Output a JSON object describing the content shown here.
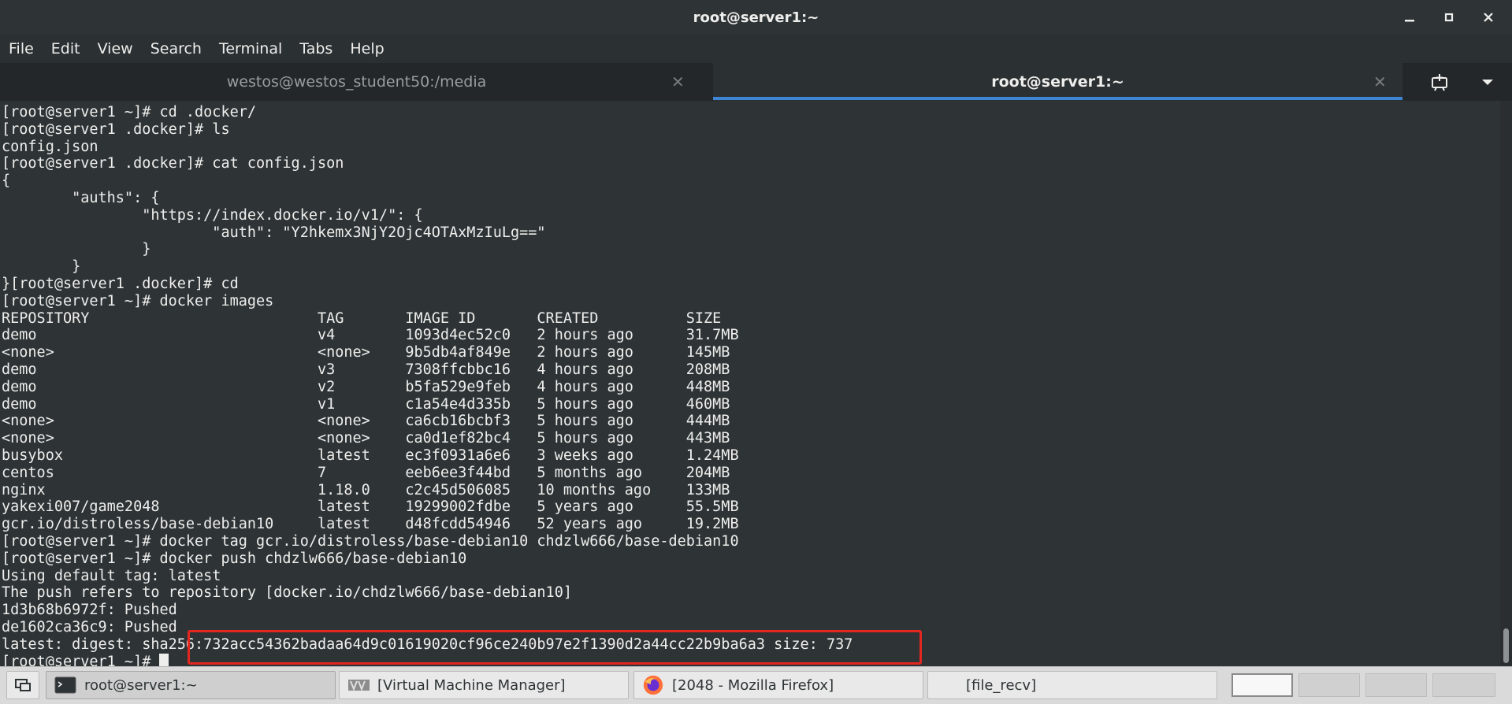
{
  "window": {
    "title": "root@server1:~",
    "icons": {
      "minimize": "minimize-icon",
      "maximize": "maximize-icon",
      "close": "close-icon"
    }
  },
  "menu": [
    "File",
    "Edit",
    "View",
    "Search",
    "Terminal",
    "Tabs",
    "Help"
  ],
  "tabs": [
    {
      "label": "westos@westos_student50:/media",
      "active": false
    },
    {
      "label": "root@server1:~",
      "active": true
    }
  ],
  "terminal": {
    "lines": [
      "[root@server1 ~]# cd .docker/",
      "[root@server1 .docker]# ls",
      "config.json",
      "[root@server1 .docker]# cat config.json",
      "{",
      "        \"auths\": {",
      "                \"https://index.docker.io/v1/\": {",
      "                        \"auth\": \"Y2hkemx3NjY2Ojc4OTAxMzIuLg==\"",
      "                }",
      "        }",
      "}[root@server1 .docker]# cd",
      "[root@server1 ~]# docker images",
      "REPOSITORY                          TAG       IMAGE ID       CREATED          SIZE",
      "demo                                v4        1093d4ec52c0   2 hours ago      31.7MB",
      "<none>                              <none>    9b5db4af849e   2 hours ago      145MB",
      "demo                                v3        7308ffcbbc16   4 hours ago      208MB",
      "demo                                v2        b5fa529e9feb   4 hours ago      448MB",
      "demo                                v1        c1a54e4d335b   5 hours ago      460MB",
      "<none>                              <none>    ca6cb16bcbf3   5 hours ago      444MB",
      "<none>                              <none>    ca0d1ef82bc4   5 hours ago      443MB",
      "busybox                             latest    ec3f0931a6e6   3 weeks ago      1.24MB",
      "centos                              7         eeb6ee3f44bd   5 months ago     204MB",
      "nginx                               1.18.0    c2c45d506085   10 months ago    133MB",
      "yakexi007/game2048                  latest    19299002fdbe   5 years ago      55.5MB",
      "gcr.io/distroless/base-debian10     latest    d48fcdd54946   52 years ago     19.2MB",
      "[root@server1 ~]# docker tag gcr.io/distroless/base-debian10 chdzlw666/base-debian10",
      "[root@server1 ~]# docker push chdzlw666/base-debian10",
      "Using default tag: latest",
      "The push refers to repository [docker.io/chdzlw666/base-debian10]",
      "1d3b68b6972f: Pushed",
      "de1602ca36c9: Pushed",
      "latest: digest: sha256:732acc54362badaa64d9c01619020cf96ce240b97e2f1390d2a44cc22b9ba6a3 size: 737"
    ],
    "prompt": "[root@server1 ~]# ",
    "highlight_color": "#e3261f"
  },
  "taskbar": {
    "items": [
      {
        "label": "root@server1:~",
        "icon": "terminal-icon",
        "active": true
      },
      {
        "label": "[Virtual Machine Manager]",
        "icon": "virt-manager-icon",
        "active": false
      },
      {
        "label": "[2048 - Mozilla Firefox]",
        "icon": "firefox-icon",
        "active": false
      },
      {
        "label": "[file_recv]",
        "icon": "folder-icon",
        "active": false
      }
    ],
    "workspaces": 4,
    "active_workspace": 1
  }
}
